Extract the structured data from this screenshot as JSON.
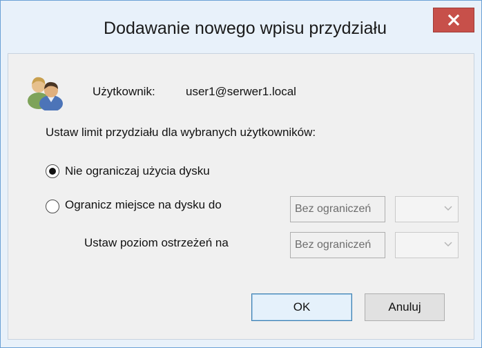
{
  "window": {
    "title": "Dodawanie nowego wpisu przydziału",
    "close_icon": "close-icon"
  },
  "user": {
    "icon": "users-icon",
    "label": "Użytkownik:",
    "value": "user1@serwer1.local"
  },
  "instruction": "Ustaw limit przydziału dla wybranych użytkowników:",
  "options": {
    "no_limit": {
      "label": "Nie ograniczaj użycia dysku",
      "selected": true
    },
    "limit": {
      "label": "Ogranicz miejsce na dysku do",
      "selected": false
    }
  },
  "limit_fields": {
    "limit_value": "Bez ograniczeń",
    "warning_label": "Ustaw poziom ostrzeżeń na",
    "warning_value": "Bez ograniczeń"
  },
  "buttons": {
    "ok": "OK",
    "cancel": "Anuluj"
  },
  "colors": {
    "close_button": "#c7504a",
    "default_button_border": "#3c7fb1",
    "window_frame": "#e8f1fa"
  }
}
